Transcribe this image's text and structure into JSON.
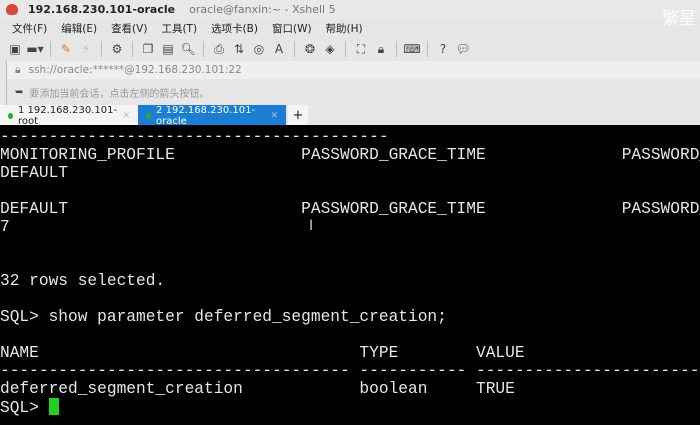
{
  "window": {
    "title": "192.168.230.101-oracle",
    "subtitle": "oracle@fanxin:~ - Xshell 5",
    "watermark": "繁星"
  },
  "menu": [
    "文件(F)",
    "编辑(E)",
    "查看(V)",
    "工具(T)",
    "选项卡(B)",
    "窗口(W)",
    "帮助(H)"
  ],
  "toolbar_icons": [
    "new-session-icon",
    "open-icon",
    "edit-icon",
    "disconnect-icon",
    "properties-icon",
    "copy-icon",
    "paste-icon",
    "find-icon",
    "print-icon",
    "transfer-icon",
    "globe-icon",
    "font-icon",
    "xftp-icon",
    "script-icon",
    "fullscreen-icon",
    "lock-icon",
    "keyboard-icon",
    "help-icon",
    "chat-icon"
  ],
  "address": "ssh://oracle:******@192.168.230.101:22",
  "hint": "要添加当前会话，点击左侧的箭头按钮。",
  "tabs": [
    {
      "label": "1 192.168.230.101-root",
      "active": false
    },
    {
      "label": "2 192.168.230.101-oracle",
      "active": true
    }
  ],
  "terminal": {
    "lines": [
      "----------------------------------------",
      "MONITORING_PROFILE             PASSWORD_GRACE_TIME              PASSWORD_GRACE_TIME",
      "DEFAULT",
      "",
      "DEFAULT                        PASSWORD_GRACE_TIME              PASSWORD_GRACE_TIME",
      "7",
      "",
      "",
      "32 rows selected.",
      "",
      "SQL> show parameter deferred_segment_creation;",
      "",
      "NAME                                 TYPE        VALUE",
      "------------------------------------ ----------- ------------------------------",
      "deferred_segment_creation            boolean     TRUE"
    ],
    "prompt": "SQL> "
  }
}
